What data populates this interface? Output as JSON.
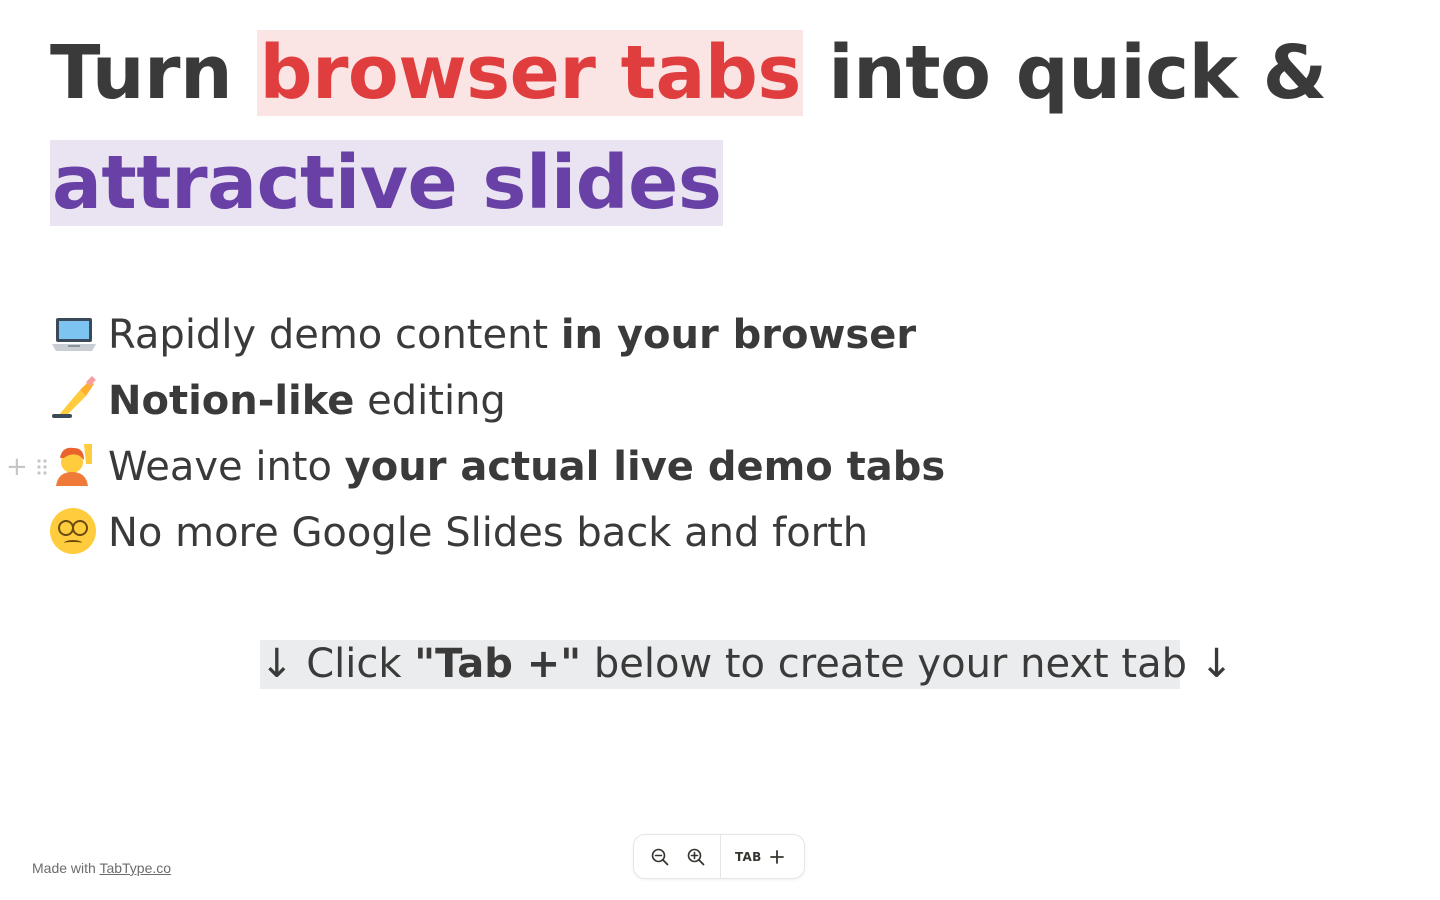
{
  "heading": {
    "part1": "Turn ",
    "highlight1": "browser tabs",
    "part2": " into quick & ",
    "highlight2": "attractive slides"
  },
  "bullets": [
    {
      "emoji": "laptop-icon",
      "text_pre": "Rapidly demo content ",
      "bold": "in your browser",
      "text_post": ""
    },
    {
      "emoji": "writing-hand-icon",
      "bold": "Notion-like",
      "text_post": " editing"
    },
    {
      "emoji": "raising-hand-icon",
      "text_pre": "Weave into ",
      "bold": "your actual live demo tabs"
    },
    {
      "emoji": "dizzy-face-icon",
      "text_pre": "No more Google Slides back and forth"
    }
  ],
  "cta": {
    "arrow_left": "↓",
    "pre": " Click  ",
    "bold": "\"Tab +\"",
    "post": " below to create your next tab ",
    "arrow_right": "↓"
  },
  "toolbar": {
    "zoom_out": "zoom-out-icon",
    "zoom_in": "zoom-in-icon",
    "tab_label": "TAB",
    "add": "plus-icon"
  },
  "footer": {
    "prefix": "Made with ",
    "link": "TabType.co"
  },
  "colors": {
    "red_text": "#e03e3e",
    "red_bg": "#fbe4e4",
    "purple_text": "#6940a5",
    "purple_bg": "#eae4f2",
    "gray_bg": "#ebeced"
  }
}
